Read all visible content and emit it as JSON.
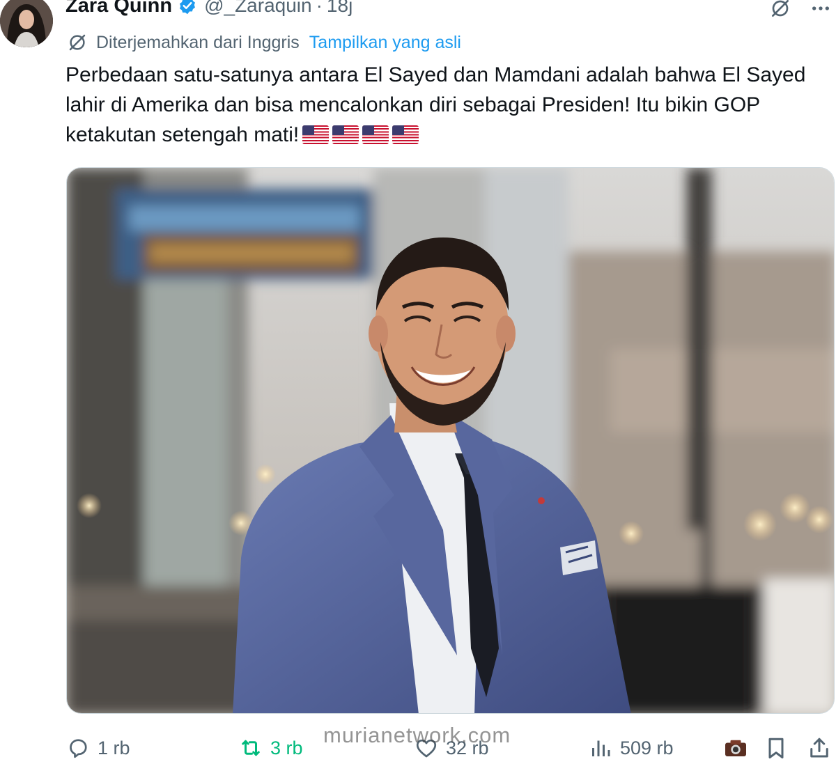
{
  "tweet": {
    "author": {
      "display_name": "Zara Quinn",
      "handle": "@_Zaraquin",
      "verified": true
    },
    "separator": "·",
    "time": "18j",
    "translation": {
      "note": "Diterjemahkan dari Inggris",
      "show_original": "Tampilkan yang asli"
    },
    "text": "Perbedaan satu-satunya antara El Sayed dan Mamdani adalah bahwa El Sayed lahir di Amerika dan bisa mencalonkan diri sebagai Presiden! Itu bikin GOP ketakutan setengah mati!",
    "emoji": [
      "us-flag",
      "us-flag",
      "us-flag",
      "us-flag"
    ],
    "media": {
      "type": "photo",
      "subject": "Smiling man with beard in a blue suit, dark tie and pocket square on a city street"
    },
    "metrics": {
      "replies": "1 rb",
      "reposts": "3 rb",
      "likes": "32 rb",
      "views": "509 rb"
    }
  },
  "watermark": "murianetwork.com",
  "colors": {
    "accent": "#1d9bf0",
    "repost_active": "#00ba7c",
    "secondary_text": "#536471",
    "primary_text": "#0f1419"
  },
  "icons": {
    "verified": "verified-badge-icon",
    "grok": "grok-icon",
    "more": "more-icon",
    "translate": "translate-icon",
    "reply": "reply-icon",
    "repost": "repost-icon",
    "like": "like-icon",
    "views": "views-icon",
    "bookmark": "bookmark-icon",
    "share": "share-icon"
  }
}
